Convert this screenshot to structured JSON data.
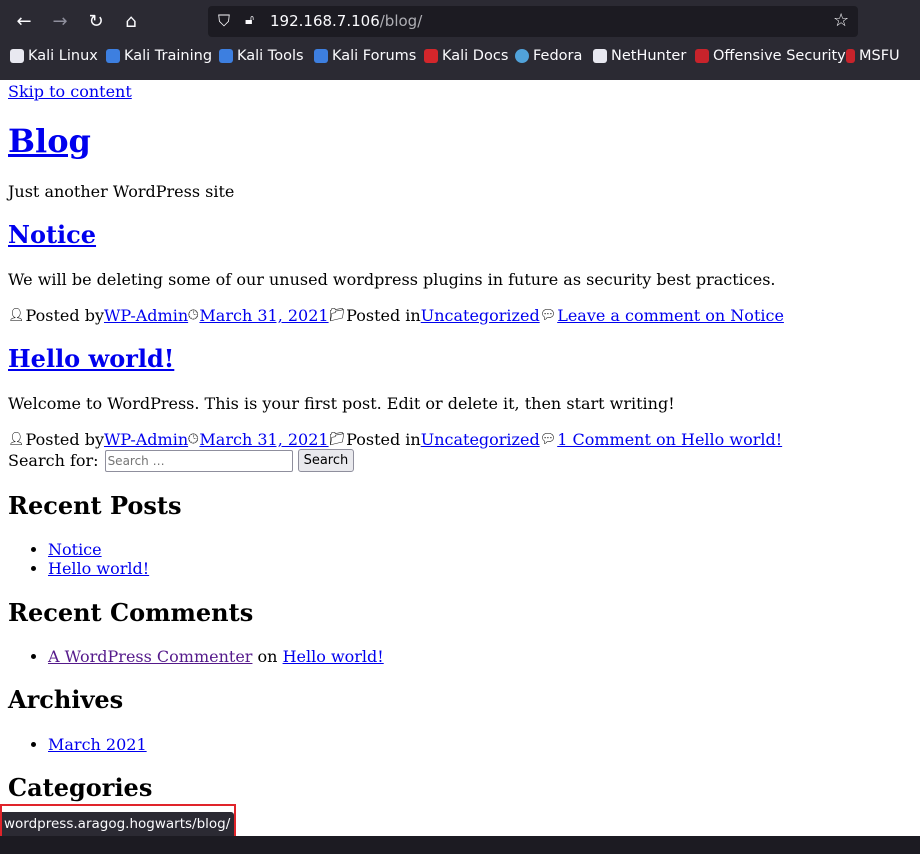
{
  "browser": {
    "url_host": "192.168.7.106",
    "url_path": "/blog/",
    "bookmarks": [
      "Kali Linux",
      "Kali Training",
      "Kali Tools",
      "Kali Forums",
      "Kali Docs",
      "Fedora",
      "NetHunter",
      "Offensive Security",
      "MSFU"
    ],
    "status_url": "wordpress.aragog.hogwarts/blog/"
  },
  "page": {
    "skip_link": "Skip to content",
    "site_title": "Blog",
    "tagline": "Just another WordPress site",
    "posts": [
      {
        "title": "Notice",
        "body": "We will be deleting some of our unused wordpress plugins in future as security best practices.",
        "posted_by_label": "Posted by",
        "author": "WP-Admin",
        "date": "March 31, 2021",
        "posted_in_label": "Posted in",
        "category": "Uncategorized",
        "comments": "Leave a comment on Notice"
      },
      {
        "title": "Hello world!",
        "body": "Welcome to WordPress. This is your first post. Edit or delete it, then start writing!",
        "posted_by_label": "Posted by",
        "author": "WP-Admin",
        "date": "March 31, 2021",
        "posted_in_label": "Posted in",
        "category": "Uncategorized",
        "comments": "1 Comment on Hello world!"
      }
    ],
    "search": {
      "label": "Search for:",
      "placeholder": "Search …",
      "button": "Search"
    },
    "widgets": {
      "recent_posts": {
        "title": "Recent Posts",
        "items": [
          "Notice",
          "Hello world!"
        ]
      },
      "recent_comments": {
        "title": "Recent Comments",
        "author": "A WordPress Commenter",
        "on_word": "on",
        "post": "Hello world!"
      },
      "archives": {
        "title": "Archives",
        "items": [
          "March 2021"
        ]
      },
      "categories": {
        "title": "Categories"
      }
    }
  },
  "colors": {
    "chrome_bg": "#2b2a33",
    "link": "#0000ee",
    "visited_link": "#551a8b",
    "highlight_box": "#e0242a"
  }
}
